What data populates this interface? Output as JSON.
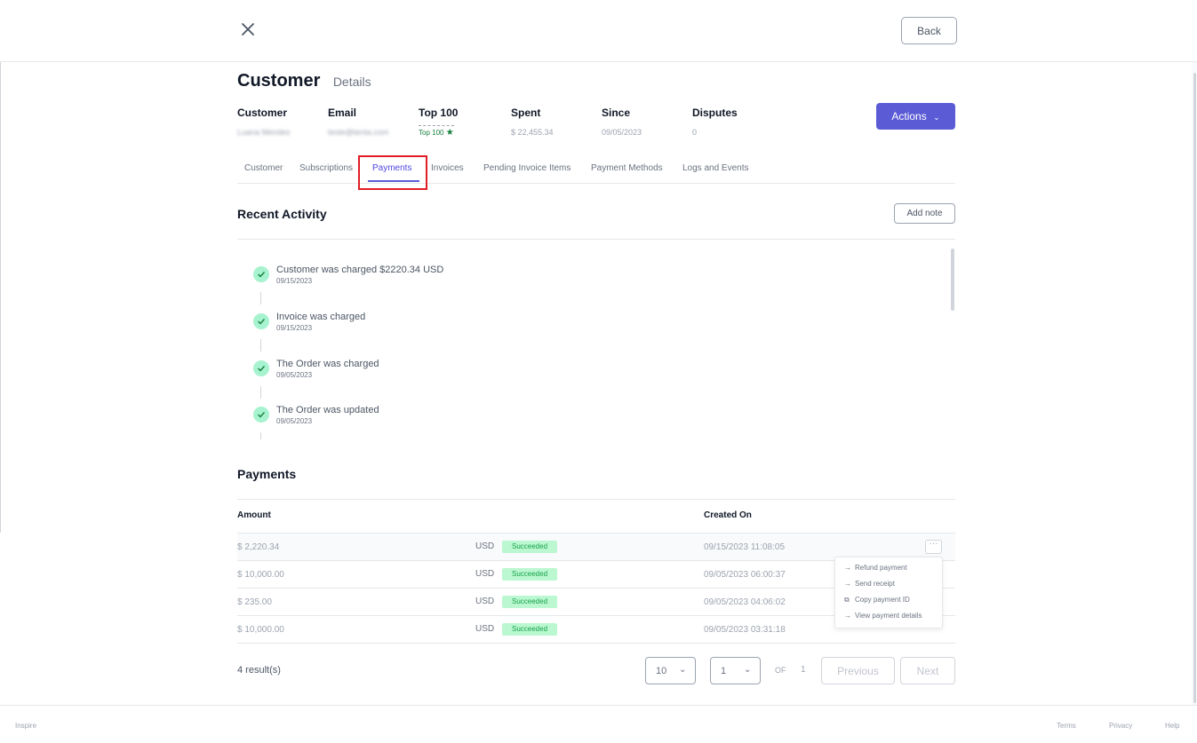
{
  "header": {
    "back_label": "Back"
  },
  "page": {
    "title": "Customer",
    "subtitle": "Details"
  },
  "customer_summary": {
    "fields": [
      {
        "label": "Customer",
        "value": "Luana Mendes"
      },
      {
        "label": "Email",
        "value": "teste@tenta.com"
      },
      {
        "label": "Top 100",
        "value": "Top 100"
      },
      {
        "label": "Spent",
        "value": "$ 22,455.34"
      },
      {
        "label": "Since",
        "value": "09/05/2023"
      },
      {
        "label": "Disputes",
        "value": "0"
      }
    ],
    "actions_label": "Actions"
  },
  "tabs": [
    {
      "label": "Customer"
    },
    {
      "label": "Subscriptions"
    },
    {
      "label": "Payments",
      "active": true
    },
    {
      "label": "Invoices"
    },
    {
      "label": "Pending Invoice Items"
    },
    {
      "label": "Payment Methods"
    },
    {
      "label": "Logs and Events"
    }
  ],
  "recent_activity": {
    "title": "Recent Activity",
    "add_note_label": "Add note",
    "items": [
      {
        "title": "Customer was charged $2220.34 USD",
        "date": "09/15/2023"
      },
      {
        "title": "Invoice was charged",
        "date": "09/15/2023"
      },
      {
        "title": "The Order was charged",
        "date": "09/05/2023"
      },
      {
        "title": "The Order was updated",
        "date": "09/05/2023"
      }
    ]
  },
  "payments": {
    "title": "Payments",
    "columns": {
      "amount": "Amount",
      "created_on": "Created On"
    },
    "rows": [
      {
        "amount": "$ 2,220.34",
        "currency": "USD",
        "status": "Succeeded",
        "created_on": "09/15/2023 11:08:05"
      },
      {
        "amount": "$ 10,000.00",
        "currency": "USD",
        "status": "Succeeded",
        "created_on": "09/05/2023 06:00:37"
      },
      {
        "amount": "$ 235.00",
        "currency": "USD",
        "status": "Succeeded",
        "created_on": "09/05/2023 04:06:02"
      },
      {
        "amount": "$ 10,000.00",
        "currency": "USD",
        "status": "Succeeded",
        "created_on": "09/05/2023 03:31:18"
      }
    ],
    "row_menu": [
      {
        "label": "Refund payment",
        "icon": "arrow-right-icon"
      },
      {
        "label": "Send receipt",
        "icon": "arrow-right-icon"
      },
      {
        "label": "Copy payment ID",
        "icon": "copy-icon"
      },
      {
        "label": "View payment details",
        "icon": "arrow-right-icon"
      }
    ],
    "results_label": "4 result(s)",
    "page_size": "10",
    "current_page": "1",
    "of_label": "OF",
    "total_pages": "1",
    "previous_label": "Previous",
    "next_label": "Next"
  },
  "footer": {
    "brand": "Inspire",
    "links": [
      "Terms",
      "Privacy",
      "Help"
    ]
  },
  "colors": {
    "accent": "#5b5bd6",
    "success": "#16a34a",
    "highlight": "#e11d26"
  }
}
